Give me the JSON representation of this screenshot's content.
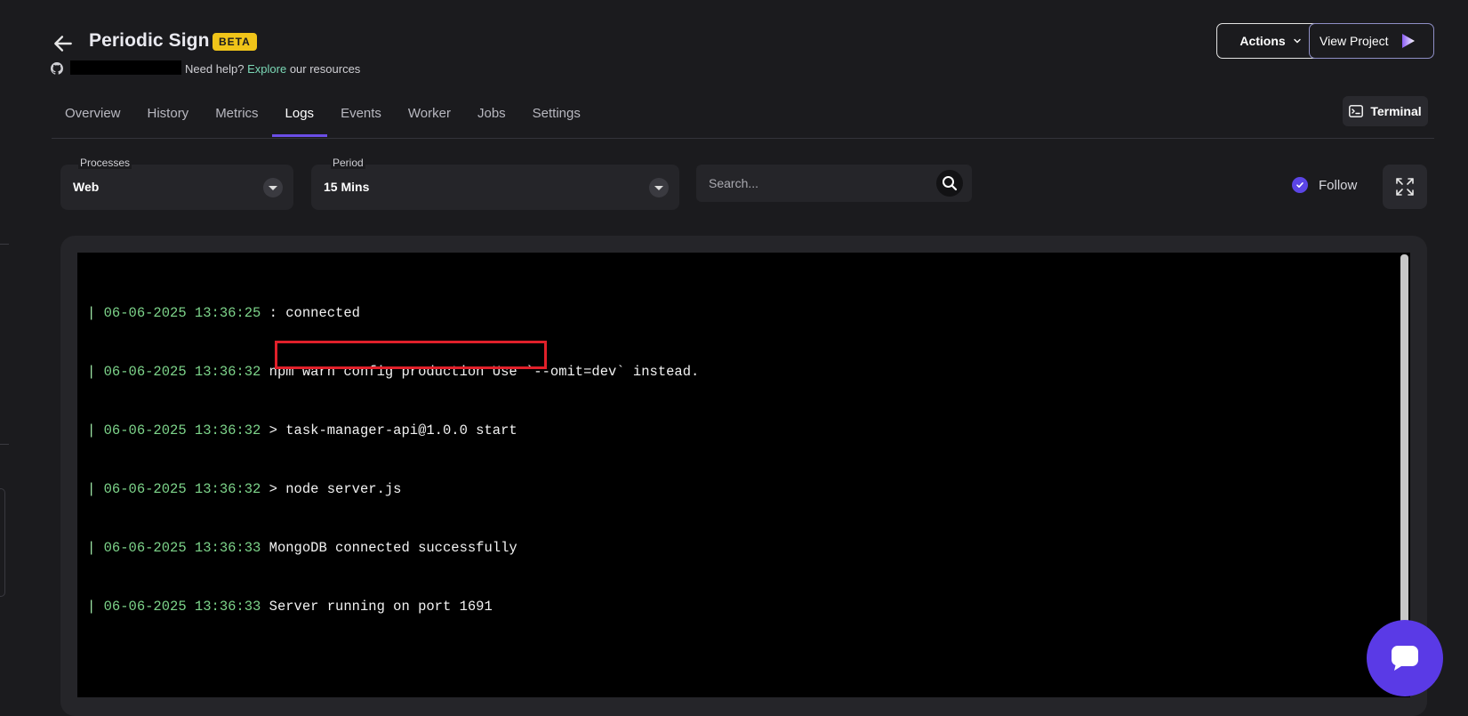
{
  "header": {
    "title": "Periodic Sign",
    "badge": "BETA",
    "help_text": "Need help?",
    "help_link": "Explore",
    "help_suffix": "our resources",
    "actions_label": "Actions",
    "view_project_label": "View Project"
  },
  "tabs": [
    {
      "label": "Overview",
      "active": false
    },
    {
      "label": "History",
      "active": false
    },
    {
      "label": "Metrics",
      "active": false
    },
    {
      "label": "Logs",
      "active": true
    },
    {
      "label": "Events",
      "active": false
    },
    {
      "label": "Worker",
      "active": false
    },
    {
      "label": "Jobs",
      "active": false
    },
    {
      "label": "Settings",
      "active": false
    }
  ],
  "terminal_label": "Terminal",
  "filters": {
    "processes_label": "Processes",
    "processes_value": "Web",
    "period_label": "Period",
    "period_value": "15 Mins",
    "search_placeholder": "Search...",
    "follow_label": "Follow",
    "follow_checked": true
  },
  "logs": [
    {
      "ts": "06-06-2025 13:36:25",
      "msg": " : connected"
    },
    {
      "ts": "06-06-2025 13:36:32",
      "msg": " npm warn config production Use `--omit=dev` instead."
    },
    {
      "ts": "06-06-2025 13:36:32",
      "msg": " > task-manager-api@1.0.0 start"
    },
    {
      "ts": "06-06-2025 13:36:32",
      "msg": " > node server.js"
    },
    {
      "ts": "06-06-2025 13:36:33",
      "msg": " MongoDB connected successfully"
    },
    {
      "ts": "06-06-2025 13:36:33",
      "msg": " Server running on port 1691"
    }
  ],
  "colors": {
    "accent": "#6b4ee6",
    "timestamp": "#7dd48a",
    "highlight": "#e0202a",
    "beta_badge": "#f0c419"
  }
}
